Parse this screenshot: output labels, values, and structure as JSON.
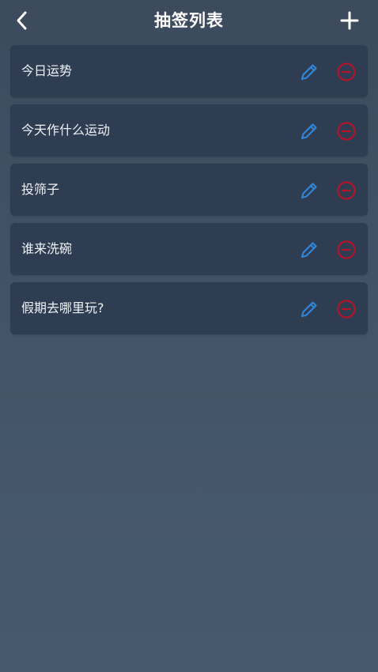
{
  "header": {
    "title": "抽签列表",
    "back_icon": "chevron-left-icon",
    "add_icon": "plus-icon"
  },
  "list": {
    "items": [
      {
        "label": "今日运势"
      },
      {
        "label": "今天作什么运动"
      },
      {
        "label": "投筛子"
      },
      {
        "label": "谁来洗碗"
      },
      {
        "label": "假期去哪里玩?"
      }
    ],
    "edit_icon": "pencil-icon",
    "delete_icon": "minus-circle-icon"
  },
  "colors": {
    "background": "#435367",
    "card": "#2f3d52",
    "edit_accent": "#2f86d9",
    "delete_accent": "#b3142b"
  }
}
